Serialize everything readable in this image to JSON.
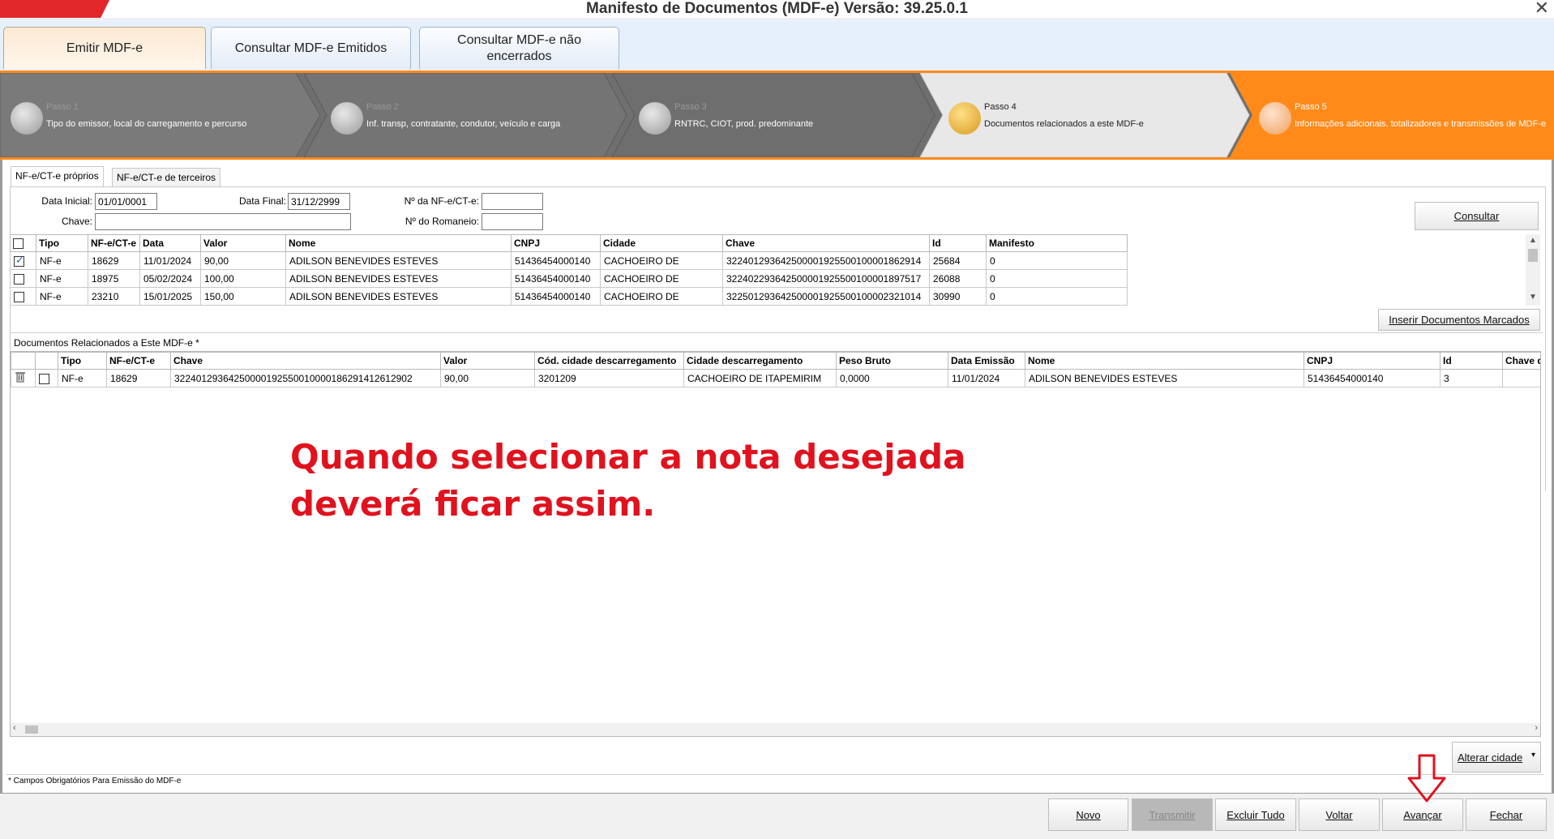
{
  "window": {
    "title": "Manifesto de Documentos (MDF-e) Versão: 39.25.0.1",
    "close_glyph": "✕"
  },
  "main_tabs": [
    {
      "label": "Emitir MDF-e"
    },
    {
      "label": "Consultar MDF-e Emitidos"
    },
    {
      "label": "Consultar MDF-e não encerrados"
    }
  ],
  "steps": [
    {
      "num": "Passo 1",
      "desc": "Tipo do emissor, local do carregamento e percurso"
    },
    {
      "num": "Passo 2",
      "desc": "Inf. transp, contratante, condutor, veículo e carga"
    },
    {
      "num": "Passo 3",
      "desc": "RNTRC, CIOT, prod. predominante"
    },
    {
      "num": "Passo 4",
      "desc": "Documentos relacionados a este MDF-e"
    },
    {
      "num": "Passo 5",
      "desc": "Informações adicionais, totalizadores e transmissões de MDF-e"
    }
  ],
  "sub_tabs": [
    {
      "label": "NF-e/CT-e próprios"
    },
    {
      "label": "NF-e/CT-e de terceiros"
    }
  ],
  "filters": {
    "data_inicial_label": "Data Inicial:",
    "data_inicial": "01/01/0001",
    "data_final_label": "Data Final:",
    "data_final": "31/12/2999",
    "chave_label": "Chave:",
    "chave": "",
    "numero_label": "Nº da NF-e/CT-e:",
    "numero": "",
    "romaneio_label": "Nº do Romaneio:",
    "romaneio": "",
    "consultar": "Consultar"
  },
  "grid1": {
    "headers": [
      "Tipo",
      "NF-e/CT-e",
      "Data",
      "Valor",
      "Nome",
      "CNPJ",
      "Cidade",
      "Chave",
      "Id",
      "Manifesto"
    ],
    "rows": [
      {
        "checked": true,
        "cells": [
          "NF-e",
          "18629",
          "11/01/2024",
          "90,00",
          "ADILSON BENEVIDES ESTEVES",
          "51436454000140",
          "CACHOEIRO DE",
          "32240129364250000192550010000186291​4",
          "25684",
          "0"
        ]
      },
      {
        "checked": false,
        "cells": [
          "NF-e",
          "18975",
          "05/02/2024",
          "100,00",
          "ADILSON BENEVIDES ESTEVES",
          "51436454000140",
          "CACHOEIRO DE",
          "322402293642500001925500100001897517",
          "26088",
          "0"
        ]
      },
      {
        "checked": false,
        "cells": [
          "NF-e",
          "23210",
          "15/01/2025",
          "150,00",
          "ADILSON BENEVIDES ESTEVES",
          "51436454000140",
          "CACHOEIRO DE",
          "322501293642500001925500100002321014",
          "30990",
          "0"
        ]
      }
    ],
    "insert_button": "Inserir Documentos Marcados"
  },
  "grid2": {
    "title": "Documentos Relacionados a Este MDF-e *",
    "headers": [
      "Tipo",
      "NF-e/CT-e",
      "Chave",
      "Valor",
      "Cód. cidade descarregamento",
      "Cidade descarregamento",
      "Peso Bruto",
      "Data Emissão",
      "Nome",
      "CNPJ",
      "Id",
      "Chave de"
    ],
    "rows": [
      {
        "cells": [
          "NF-e",
          "18629",
          "32240129364250000192550010000186291412612902",
          "90,00",
          "3201209",
          "CACHOEIRO DE ITAPEMIRIM",
          "0,0000",
          "11/01/2024",
          "ADILSON BENEVIDES ESTEVES",
          "51436454000140",
          "3",
          ""
        ]
      }
    ]
  },
  "annotation": "Quando selecionar a nota desejada deverá ficar assim.",
  "alterar_cidade": "Alterar cidade",
  "footnote": "* Campos Obrigatórios Para Emissão do MDF-e",
  "bottom_buttons": {
    "novo": "Novo",
    "transmitir": "Transmitir",
    "excluir_tudo": "Excluir Tudo",
    "voltar": "Voltar",
    "avancar": "Avançar",
    "fechar": "Fechar"
  },
  "colors": {
    "accent_orange": "#ff8a1a",
    "annotation_red": "#e0121e",
    "step_gray": "#6f6f6f"
  }
}
